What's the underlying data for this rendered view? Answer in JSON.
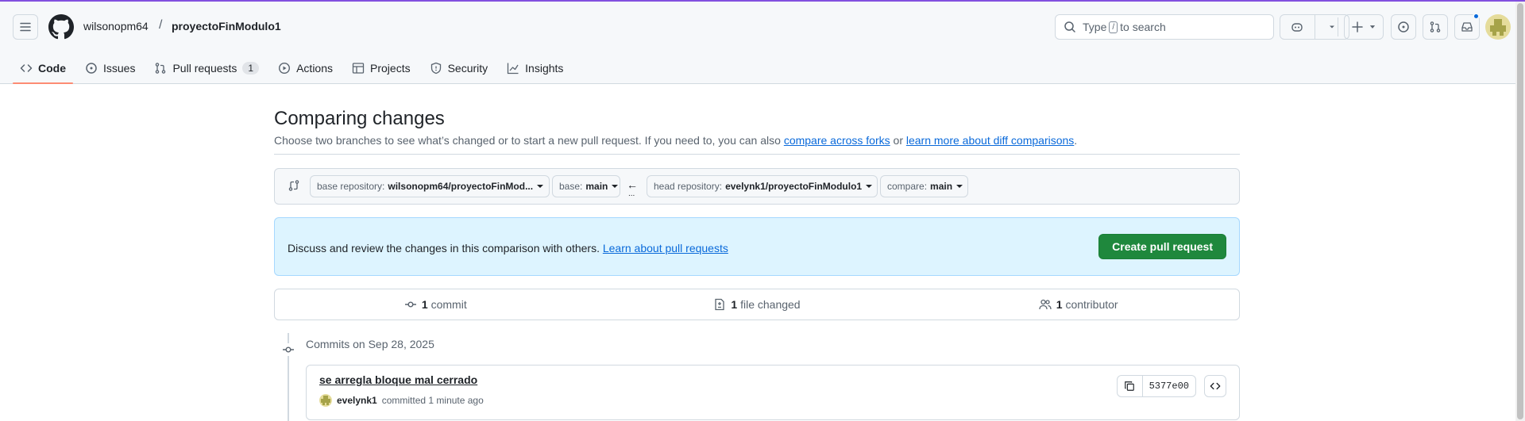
{
  "header": {
    "owner": "wilsonopm64",
    "separator": "/",
    "repo": "proyectoFinModulo1",
    "search_prefix": "Type",
    "search_key": "/",
    "search_suffix": "to search"
  },
  "tabs": [
    {
      "label": "Code",
      "icon": "code-icon"
    },
    {
      "label": "Issues",
      "icon": "issue-opened-icon"
    },
    {
      "label": "Pull requests",
      "icon": "git-pull-request-icon",
      "count": "1"
    },
    {
      "label": "Actions",
      "icon": "play-icon"
    },
    {
      "label": "Projects",
      "icon": "table-icon"
    },
    {
      "label": "Security",
      "icon": "shield-icon"
    },
    {
      "label": "Insights",
      "icon": "graph-icon"
    }
  ],
  "main": {
    "title": "Comparing changes",
    "subtitle_pre": "Choose two branches to see what’s changed or to start a new pull request. If you need to, you can also",
    "link_forks": "compare across forks",
    "subtitle_or": "or",
    "link_learn_diff": "learn more about diff comparisons",
    "subtitle_end": "."
  },
  "range": {
    "base_repo_label": "base repository:",
    "base_repo_value": "wilsonopm64/proyectoFinMod...",
    "base_label": "base:",
    "base_value": "main",
    "arrow": "←",
    "dots": "...",
    "head_repo_label": "head repository:",
    "head_repo_value": "evelynk1/proyectoFinModulo1",
    "compare_label": "compare:",
    "compare_value": "main"
  },
  "flash": {
    "message": "Discuss and review the changes in this comparison with others.",
    "link": "Learn about pull requests",
    "button": "Create pull request"
  },
  "summary": {
    "commits_count": "1",
    "commits_label": "commit",
    "files_count": "1",
    "files_label": "file changed",
    "contributors_count": "1",
    "contributors_label": "contributor"
  },
  "commits": {
    "heading": "Commits on Sep 28, 2025",
    "items": [
      {
        "message": "se arregla bloque mal cerrado",
        "author": "evelynk1",
        "action": "committed 1 minute ago",
        "sha": "5377e00"
      }
    ]
  },
  "colors": {
    "accent_tab": "#fd8c73",
    "primary_button": "#1f883d",
    "link": "#0969da",
    "flash_bg": "#ddf4ff"
  }
}
